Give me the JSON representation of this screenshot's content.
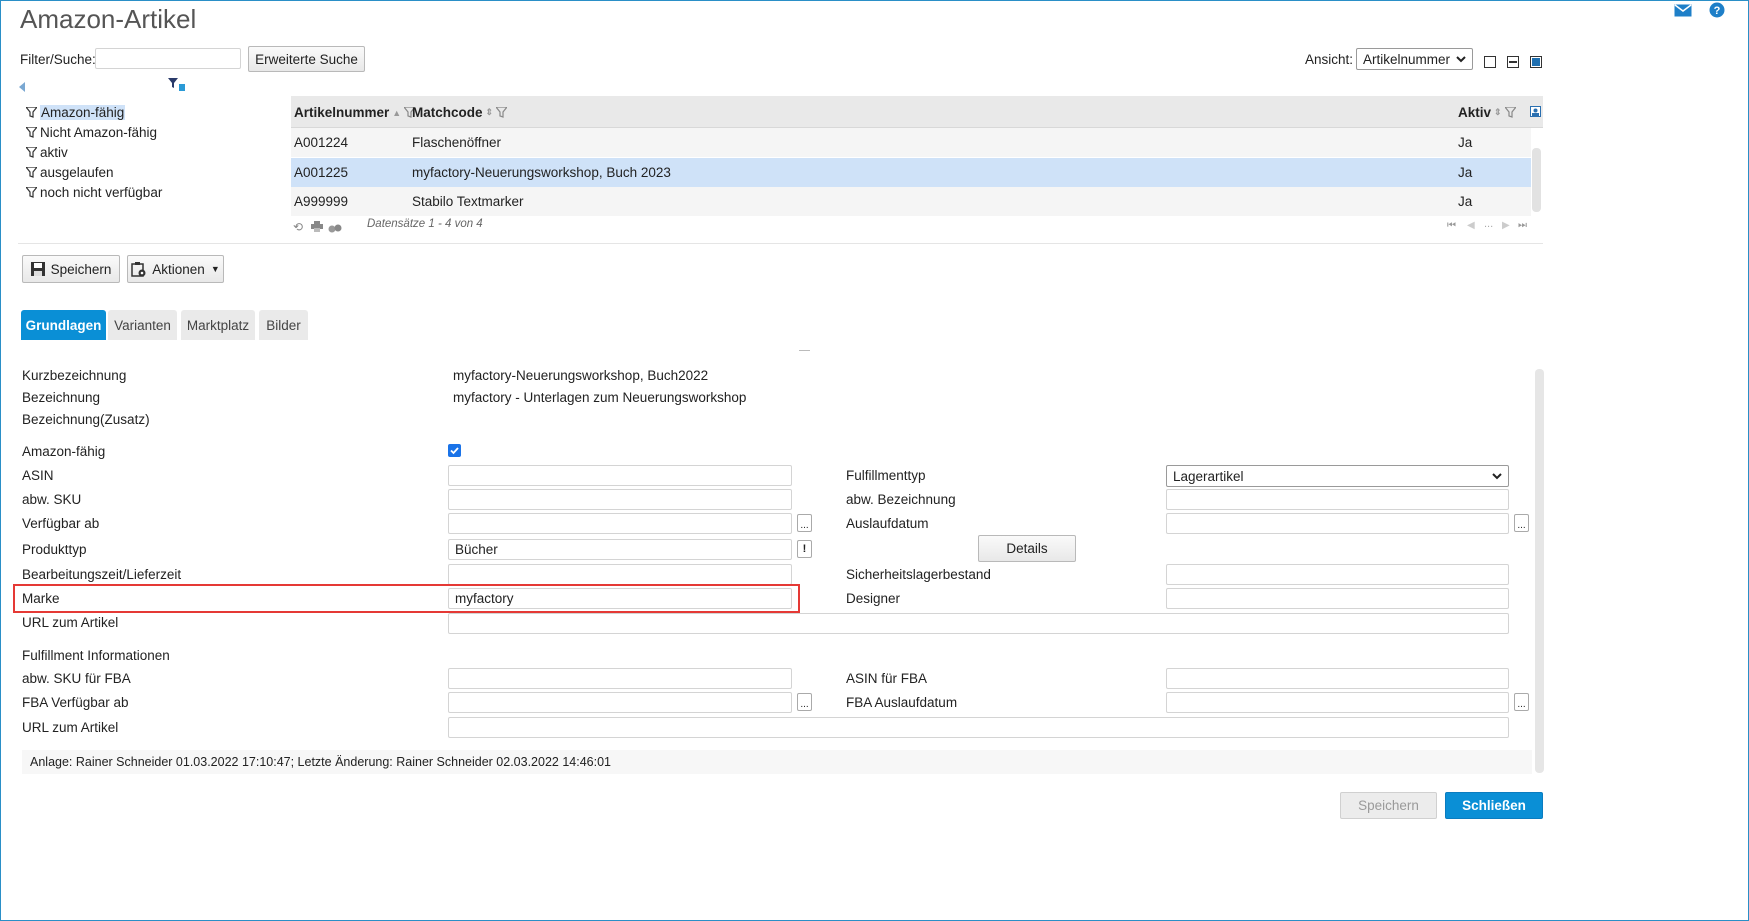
{
  "window": {
    "title": "Amazon-Artikel"
  },
  "filter": {
    "label": "Filter/Suche:",
    "value": "",
    "advanced_label": "Erweiterte Suche"
  },
  "view": {
    "label": "Ansicht:",
    "selected": "Artikelnummer"
  },
  "filters": [
    "Amazon-fähig",
    "Nicht Amazon-fähig",
    "aktiv",
    "ausgelaufen",
    "noch nicht verfügbar"
  ],
  "grid": {
    "columns": [
      "Artikelnummer",
      "Matchcode",
      "Aktiv"
    ],
    "rows": [
      {
        "nr": "A001224",
        "matchcode": "Flaschenöffner",
        "aktiv": "Ja"
      },
      {
        "nr": "A001225",
        "matchcode": "myfactory-Neuerungsworkshop, Buch 2023",
        "aktiv": "Ja"
      },
      {
        "nr": "A999999",
        "matchcode": "Stabilo Textmarker",
        "aktiv": "Ja"
      }
    ],
    "status": "Datensätze 1 - 4 von 4",
    "pager_ellipsis": "..."
  },
  "toolbar": {
    "save": "Speichern",
    "actions": "Aktionen"
  },
  "tabs": [
    "Grundlagen",
    "Varianten",
    "Marktplatz",
    "Bilder"
  ],
  "form": {
    "kurz": {
      "label": "Kurzbezeichnung",
      "value": "myfactory-Neuerungsworkshop, Buch2022"
    },
    "bez": {
      "label": "Bezeichnung",
      "value": "myfactory - Unterlagen zum Neuerungsworkshop"
    },
    "bez_zusatz": {
      "label": "Bezeichnung(Zusatz)"
    },
    "amazon": {
      "label": "Amazon-fähig",
      "checked": true
    },
    "asin": {
      "label": "ASIN",
      "value": ""
    },
    "sku": {
      "label": "abw. SKU",
      "value": ""
    },
    "verf": {
      "label": "Verfügbar ab",
      "value": ""
    },
    "produkttyp": {
      "label": "Produkttyp",
      "value": "Bücher"
    },
    "bearb": {
      "label": "Bearbeitungszeit/Lieferzeit",
      "value": ""
    },
    "marke": {
      "label": "Marke",
      "value": "myfactory"
    },
    "url": {
      "label": "URL zum Artikel",
      "value": ""
    },
    "fulfillmenttyp": {
      "label": "Fulfillmenttyp",
      "value": "Lagerartikel"
    },
    "abw_bez": {
      "label": "abw. Bezeichnung",
      "value": ""
    },
    "auslauf": {
      "label": "Auslaufdatum",
      "value": ""
    },
    "details": "Details",
    "sicherheit": {
      "label": "Sicherheitslagerbestand",
      "value": ""
    },
    "designer": {
      "label": "Designer",
      "value": ""
    },
    "fba_section": "Fulfillment Informationen",
    "fba_sku": {
      "label": "abw. SKU für FBA",
      "value": ""
    },
    "fba_verf": {
      "label": "FBA Verfügbar ab",
      "value": ""
    },
    "fba_url": {
      "label": "URL zum Artikel",
      "value": ""
    },
    "asin_fba": {
      "label": "ASIN für FBA",
      "value": ""
    },
    "fba_auslauf": {
      "label": "FBA Auslaufdatum",
      "value": ""
    },
    "dots": "...",
    "excl": "!"
  },
  "footer": {
    "info": "Anlage: Rainer Schneider 01.03.2022 17:10:47; Letzte Änderung: Rainer Schneider 02.03.2022 14:46:01"
  },
  "bottom": {
    "save": "Speichern",
    "close": "Schließen"
  },
  "colors": {
    "accent": "#0a8fd6",
    "selected_row": "#cfe2f8",
    "highlight": "#e53935"
  }
}
